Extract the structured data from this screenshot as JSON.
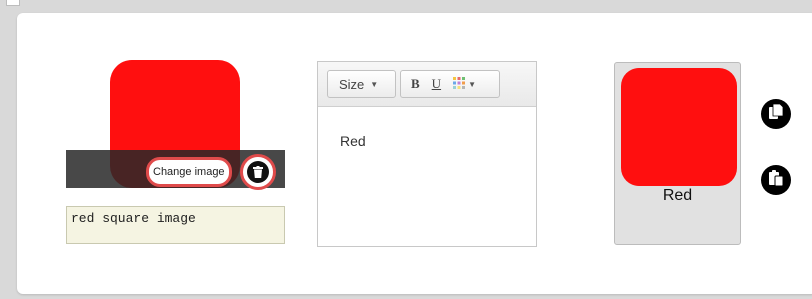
{
  "colors": {
    "square_red": "#ff0f0f",
    "button_outline": "#e04b4b"
  },
  "image_editor": {
    "change_image_label": "Change image",
    "delete_icon": "trash-icon",
    "caption_value": "red square image"
  },
  "text_editor": {
    "toolbar": {
      "size_label": "Size",
      "bold_label": "B",
      "underline_label": "U",
      "color_icon": "color-palette-icon"
    },
    "content": "Red"
  },
  "preview": {
    "label": "Red"
  },
  "actions": {
    "copy_icon": "copy-icon",
    "paste_icon": "paste-icon"
  }
}
